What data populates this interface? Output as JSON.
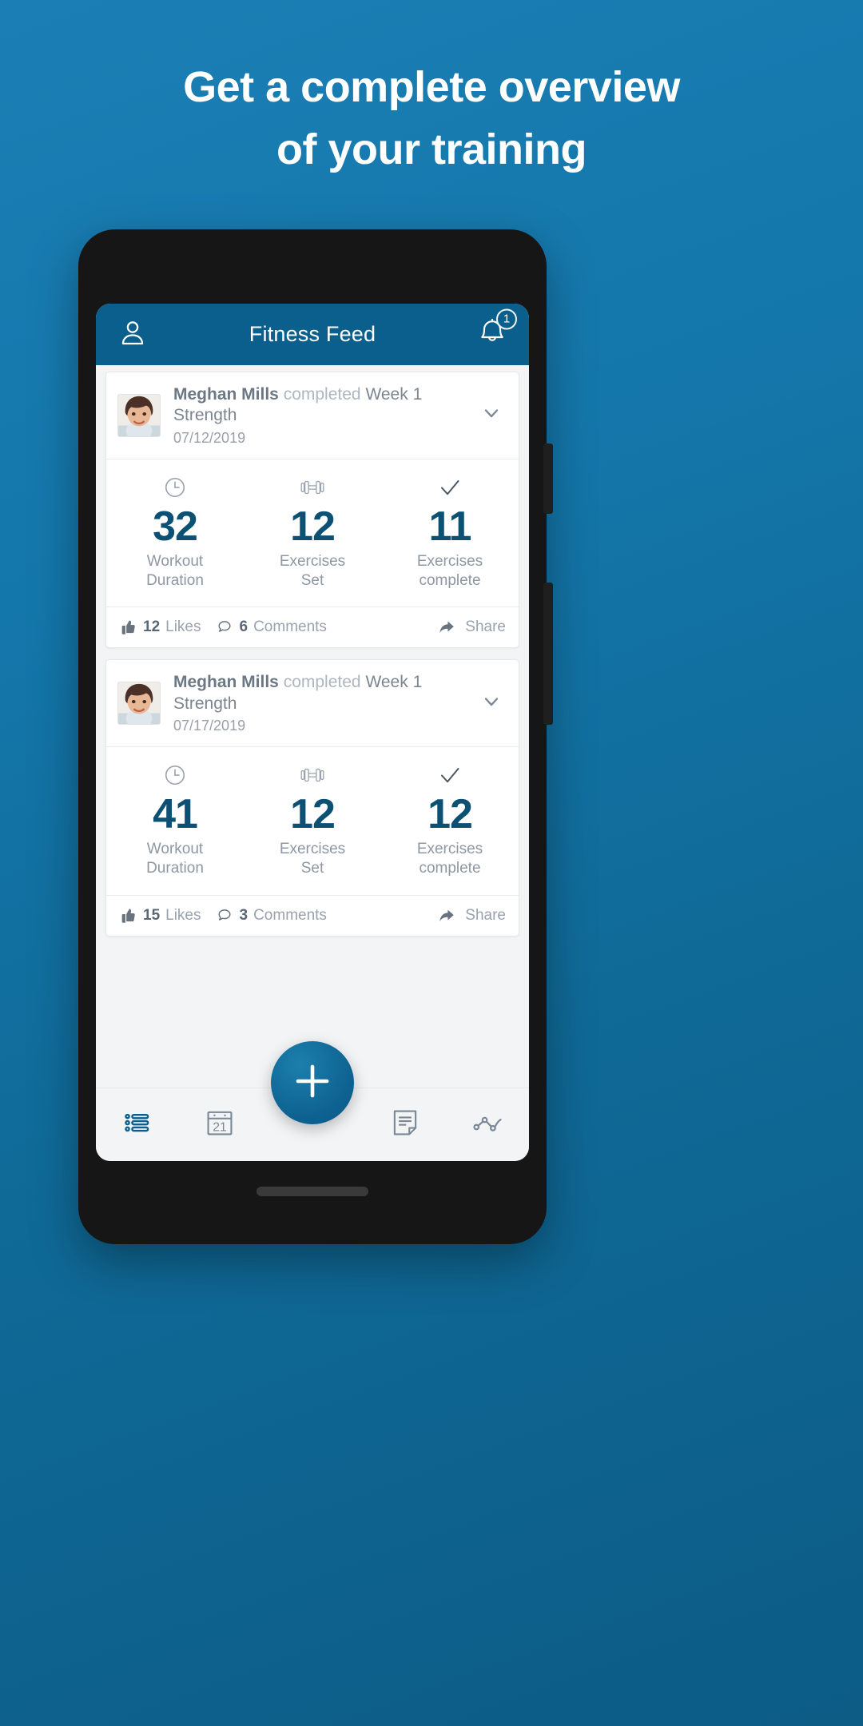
{
  "promo": {
    "headline_line1": "Get a complete overview",
    "headline_line2": "of your training",
    "bg_color": "#0f6996"
  },
  "app": {
    "appbar": {
      "title": "Fitness Feed",
      "profile_icon": "person-icon",
      "notification_icon": "bell-icon",
      "notification_badge": "1",
      "bg_color": "#0a5f8c"
    },
    "feed": {
      "cards": [
        {
          "user": "Meghan Mills",
          "verb": "completed",
          "workout": "Week 1 Strength",
          "date": "07/12/2019",
          "expand_icon": "chevron-down-icon",
          "stats": [
            {
              "icon": "clock-icon",
              "value": "32",
              "label_line1": "Workout",
              "label_line2": "Duration"
            },
            {
              "icon": "dumbbell-icon",
              "value": "12",
              "label_line1": "Exercises",
              "label_line2": "Set"
            },
            {
              "icon": "check-icon",
              "value": "11",
              "label_line1": "Exercises",
              "label_line2": "complete"
            }
          ],
          "likes_count": "12",
          "likes_label": "Likes",
          "comments_count": "6",
          "comments_label": "Comments",
          "share_label": "Share"
        },
        {
          "user": "Meghan Mills",
          "verb": "completed",
          "workout": "Week 1 Strength",
          "date": "07/17/2019",
          "expand_icon": "chevron-down-icon",
          "stats": [
            {
              "icon": "clock-icon",
              "value": "41",
              "label_line1": "Workout",
              "label_line2": "Duration"
            },
            {
              "icon": "dumbbell-icon",
              "value": "12",
              "label_line1": "Exercises",
              "label_line2": "Set"
            },
            {
              "icon": "check-icon",
              "value": "12",
              "label_line1": "Exercises",
              "label_line2": "complete"
            }
          ],
          "likes_count": "15",
          "likes_label": "Likes",
          "comments_count": "3",
          "comments_label": "Comments",
          "share_label": "Share"
        }
      ]
    },
    "bottom_nav": {
      "items": [
        {
          "icon": "list-icon",
          "active": true
        },
        {
          "icon": "calendar-icon",
          "day": "21",
          "active": false
        },
        {
          "icon": "note-icon",
          "active": false
        },
        {
          "icon": "chart-line-icon",
          "active": false
        }
      ],
      "fab_icon": "plus-icon",
      "fab_color": "#0d6190",
      "active_color": "#0a5f8c"
    }
  }
}
